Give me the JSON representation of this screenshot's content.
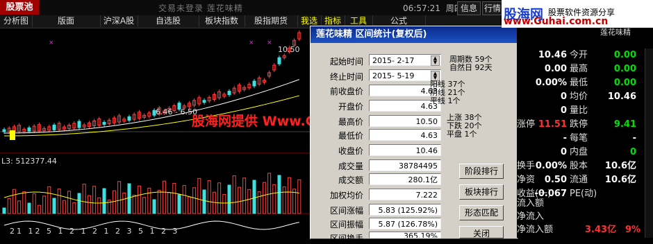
{
  "titlebar": {
    "logo": "股票池",
    "status": "交易未登录  莲花味精",
    "clock": "06:57:21",
    "weekday": "周四",
    "buttons": [
      "信息",
      "行情"
    ]
  },
  "menubar": {
    "items": [
      "分析图",
      "版面",
      "沪深A股",
      "自选股",
      "板块指数",
      "股指期货",
      "我选",
      "指标",
      "工具",
      "公式"
    ]
  },
  "chart": {
    "price_high_label": "10.50",
    "range_label": "6.46 - 6.50",
    "volume_label": "L3: 512377.44",
    "bottom_numbers": "21 12 5 1 2 1 2   1 2 3 5 1 2 3"
  },
  "overlay_text": "股海网提供 Www.Guhai.Com.CN",
  "watermark": {
    "logo": "股海网",
    "tagline": "股票软件资源分享",
    "url": "www.Guhai.com.cn"
  },
  "dialog": {
    "title": "莲花味精  区间统计(复权后)",
    "start_label": "起始时间",
    "start_value": "2015- 2-17",
    "end_label": "终止时间",
    "end_value": "2015- 5-19",
    "fields": [
      {
        "label": "前收盘价",
        "value": "4.63"
      },
      {
        "label": "开盘价",
        "value": "4.63"
      },
      {
        "label": "最高价",
        "value": "10.50"
      },
      {
        "label": "最低价",
        "value": "4.63"
      },
      {
        "label": "收盘价",
        "value": "10.46"
      },
      {
        "label": "成交量",
        "value": "38784495"
      },
      {
        "label": "成交额",
        "value": "280.1亿"
      },
      {
        "label": "加权均价",
        "value": "7.222"
      },
      {
        "label": "区间涨幅",
        "value": "5.83 (125.92%)"
      },
      {
        "label": "区间振幅",
        "value": "5.87 (126.78%)"
      },
      {
        "label": "区间换手",
        "value": "365.19%"
      }
    ],
    "period_info": [
      "周期数 59个",
      "自然日 92天"
    ],
    "candle_info": [
      "阳线 37个",
      "阴线 21个",
      "平线 1个"
    ],
    "move_info": [
      "上涨 38个",
      "下跌 20个",
      "平盘 1个"
    ],
    "buttons": {
      "stage_rank": "阶段排行",
      "sector_rank": "板块排行",
      "pattern_match": "形态匹配",
      "close": "关闭"
    }
  },
  "right_panel": {
    "rows": [
      {
        "a": "10.46",
        "al": "今开",
        "b": "0.00"
      },
      {
        "a": "0.00",
        "al": "最高",
        "b": "0.00"
      },
      {
        "a": "0.00%",
        "al": "最低",
        "b": "0.00"
      },
      {
        "a": "0",
        "al": "均价",
        "b": "10.46"
      },
      {
        "a": "0",
        "al": "量比",
        "b": ""
      },
      {
        "a": "11.51",
        "al": "跌停",
        "b": "9.41"
      },
      {
        "a": "-",
        "al": "每笔",
        "b": "-"
      },
      {
        "a": "0",
        "al": "内盘",
        "b": "0"
      },
      {
        "a": "0.00%",
        "al": "股本",
        "b": "10.6亿"
      },
      {
        "a": "0.50",
        "al": "流通",
        "b": "10.6亿"
      },
      {
        "a": "-0.067",
        "al": "PE(动)",
        "b": ""
      }
    ],
    "prefix_labels": [
      "",
      "",
      "",
      "",
      "",
      "涨停",
      "",
      "",
      "换手",
      "净资",
      "收益(一)"
    ],
    "flow": [
      {
        "label": "流入额",
        "value": ""
      },
      {
        "label": "净流入",
        "value": ""
      },
      {
        "label": "净流入额",
        "value": "3.43亿",
        "pct": "9%"
      }
    ],
    "header_name": "莲花味精"
  }
}
